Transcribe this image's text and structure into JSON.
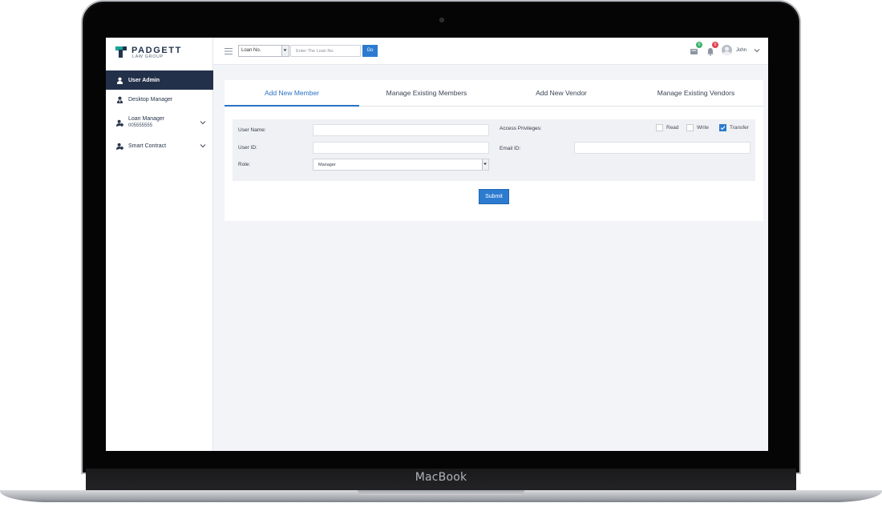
{
  "device": {
    "brand_label": "MacBook"
  },
  "logo": {
    "name": "PADGETT",
    "sub": "LAW GROUP"
  },
  "sidebar": {
    "items": [
      {
        "label": "User Admin",
        "active": true,
        "icon": "user-icon"
      },
      {
        "label": "Desktop Manager",
        "icon": "manager-icon"
      },
      {
        "label": "Loan Manager",
        "sub": "005555555",
        "icon": "loan-icon",
        "expandable": true
      },
      {
        "label": "Smart Contract",
        "icon": "contract-icon",
        "expandable": true
      }
    ]
  },
  "topbar": {
    "loan_select": "Loan No.",
    "loan_input_placeholder": "Enter The Loan No.",
    "go_label": "Go",
    "messages_badge": "0",
    "alerts_badge": "0",
    "user_name": "John"
  },
  "tabs": [
    {
      "label": "Add New Member",
      "active": true
    },
    {
      "label": "Manage Existing Members"
    },
    {
      "label": "Add New Vendor"
    },
    {
      "label": "Manage Existing Vendors"
    }
  ],
  "form": {
    "user_name_label": "User Name:",
    "user_id_label": "User ID:",
    "role_label": "Role:",
    "role_value": "Manager",
    "access_label": "Access Privileges:",
    "email_label": "Email ID:",
    "privileges": [
      {
        "label": "Read",
        "checked": false
      },
      {
        "label": "Write",
        "checked": false
      },
      {
        "label": "Transfer",
        "checked": true
      }
    ],
    "submit_label": "Submit"
  },
  "colors": {
    "accent": "#2c7bd0",
    "sidebar_active": "#23304a",
    "badge_green": "#3db36b",
    "badge_red": "#e0464f"
  }
}
